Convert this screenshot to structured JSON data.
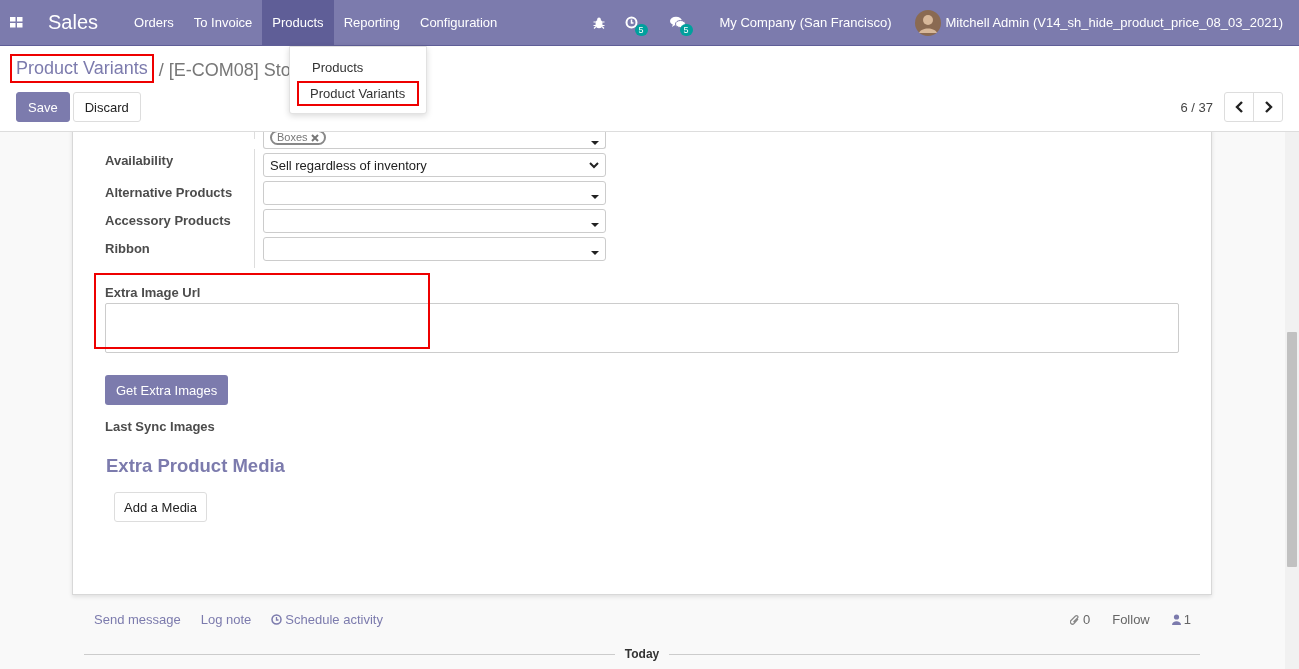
{
  "navbar": {
    "app_name": "Sales",
    "menus": [
      {
        "label": "Orders",
        "selected": false
      },
      {
        "label": "To Invoice",
        "selected": false
      },
      {
        "label": "Products",
        "selected": true
      },
      {
        "label": "Reporting",
        "selected": false
      },
      {
        "label": "Configuration",
        "selected": false
      }
    ],
    "activity_count": "5",
    "message_count": "5",
    "company": "My Company (San Francisco)",
    "user": "Mitchell Admin (V14_sh_hide_product_price_08_03_2021)"
  },
  "dropdown": {
    "items": [
      {
        "label": "Products",
        "highlighted": false
      },
      {
        "label": "Product Variants",
        "highlighted": true
      }
    ]
  },
  "breadcrumb": {
    "parent": "Product Variants",
    "parent_highlighted": true,
    "separator": "/",
    "current": "[E-COM08] Sto"
  },
  "buttons": [
    "Save",
    "Discard"
  ],
  "pager": {
    "value": "6 / 37"
  },
  "form": {
    "fields": [
      {
        "kind": "tags",
        "tags": [
          "Boxes"
        ]
      },
      {
        "kind": "select",
        "label": "Availability",
        "value": "Sell regardless of inventory"
      },
      {
        "kind": "many2many",
        "label": "Alternative Products"
      },
      {
        "kind": "many2many",
        "label": "Accessory Products"
      },
      {
        "kind": "many2one",
        "label": "Ribbon"
      }
    ],
    "extra_image": {
      "label": "Extra Image Url",
      "highlighted": true
    },
    "action_button": "Get Extra Images",
    "last_sync_label": "Last Sync Images",
    "media_title": "Extra Product Media",
    "media_button": "Add a Media"
  },
  "chatter": {
    "actions": [
      "Send message",
      "Log note",
      "Schedule activity"
    ],
    "attachments": "0",
    "follow": "Follow",
    "followers": "1",
    "separator": "Today"
  }
}
